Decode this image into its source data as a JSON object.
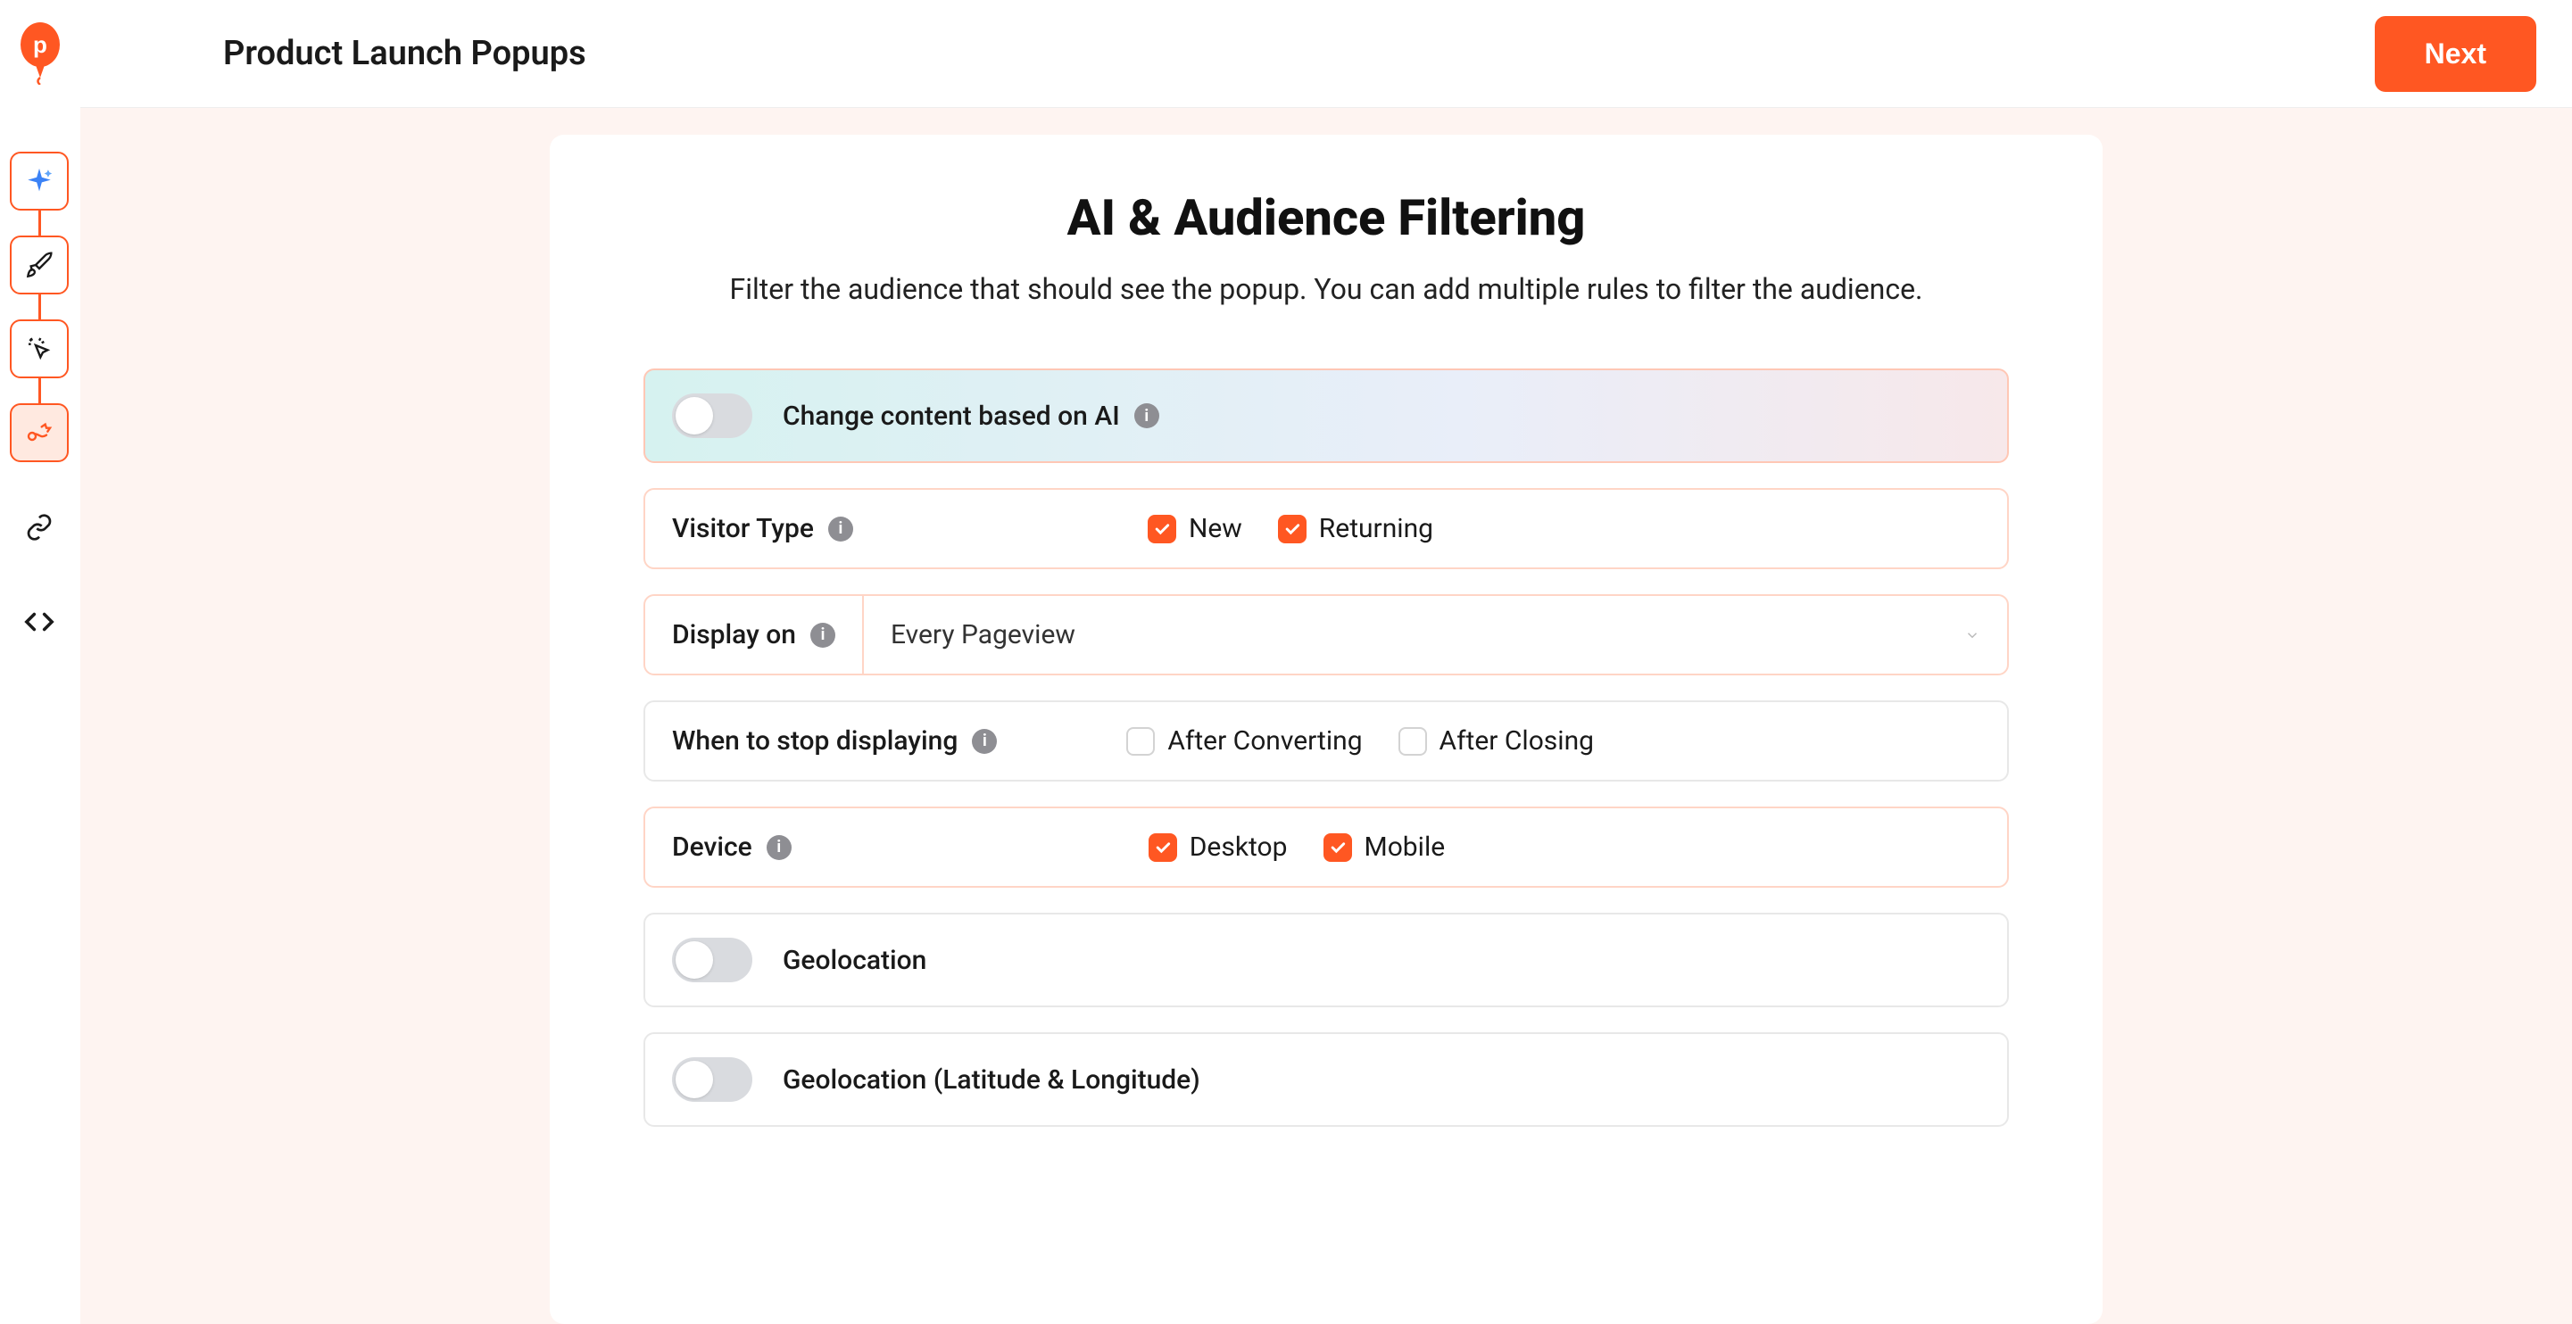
{
  "header": {
    "title": "Product Launch Popups",
    "next_label": "Next"
  },
  "sidebar": {
    "items": [
      {
        "name": "sparkle-icon",
        "active": false,
        "bordered": true
      },
      {
        "name": "rocket-icon",
        "active": false,
        "bordered": true
      },
      {
        "name": "cursor-click-icon",
        "active": false,
        "bordered": true
      },
      {
        "name": "trigger-icon",
        "active": true,
        "bordered": true
      },
      {
        "name": "link-icon",
        "active": false,
        "bordered": false
      },
      {
        "name": "code-icon",
        "active": false,
        "bordered": false
      }
    ]
  },
  "section": {
    "title": "AI & Audience Filtering",
    "subtitle": "Filter the audience that should see the popup. You can add multiple rules to filter the audience."
  },
  "filters": {
    "ai": {
      "label": "Change content based on AI",
      "enabled": false
    },
    "visitor_type": {
      "label": "Visitor Type",
      "options": {
        "new": {
          "label": "New",
          "checked": true
        },
        "returning": {
          "label": "Returning",
          "checked": true
        }
      }
    },
    "display_on": {
      "label": "Display on",
      "value": "Every Pageview"
    },
    "stop_displaying": {
      "label": "When to stop displaying",
      "options": {
        "after_converting": {
          "label": "After Converting",
          "checked": false
        },
        "after_closing": {
          "label": "After Closing",
          "checked": false
        }
      }
    },
    "device": {
      "label": "Device",
      "options": {
        "desktop": {
          "label": "Desktop",
          "checked": true
        },
        "mobile": {
          "label": "Mobile",
          "checked": true
        }
      }
    },
    "geolocation": {
      "label": "Geolocation",
      "enabled": false
    },
    "geolocation_latlng": {
      "label": "Geolocation (Latitude & Longitude)",
      "enabled": false
    }
  }
}
